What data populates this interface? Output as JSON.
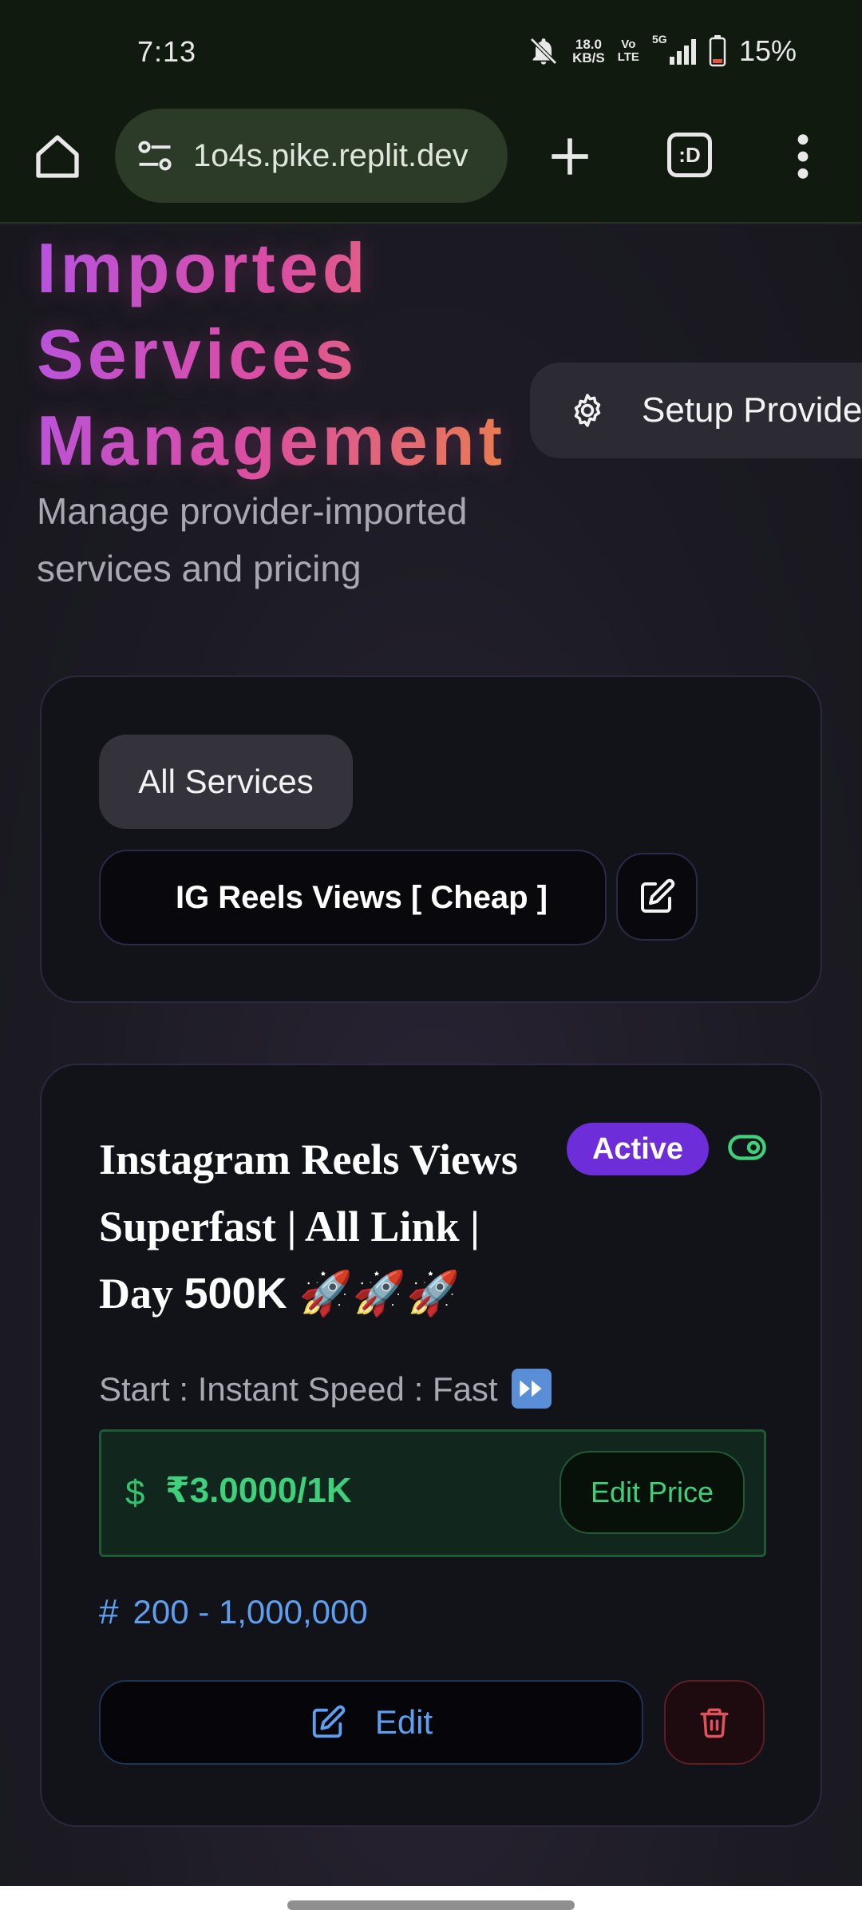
{
  "status_bar": {
    "time": "7:13",
    "net_speed_value": "18.0",
    "net_speed_unit": "KB/S",
    "volte_top": "Vo",
    "volte_bottom": "LTE",
    "signal_label": "5G",
    "battery": "15%",
    "icons": [
      "bell-off-icon",
      "signal-icon",
      "battery-icon"
    ]
  },
  "browser": {
    "url": "1o4s.pike.replit.dev",
    "tab_switcher_label": ":D",
    "icons": [
      "home-icon",
      "site-settings-icon",
      "plus-icon",
      "more-vert-icon"
    ]
  },
  "header": {
    "title_lines": [
      "Imported",
      "Services",
      "Management"
    ],
    "subtitle": "Manage provider-imported services and pricing",
    "setup_button": "Setup Provider"
  },
  "filters": {
    "all_services": "All Services",
    "category": "IG Reels Views [ Cheap ]"
  },
  "service": {
    "name": "Instagram Reels Views Superfast | All Link | Day",
    "name_tail": "500K 🚀🚀🚀",
    "status": "Active",
    "meta": "Start : Instant Speed : Fast",
    "currency_symbol": "$",
    "price": "₹3.0000/1K",
    "edit_price_label": "Edit Price",
    "range_symbol": "#",
    "range": "200 - 1,000,000",
    "edit_label": "Edit"
  },
  "colors": {
    "title_gradient": [
      "#b455e6",
      "#dd4fa2",
      "#ee8a3a"
    ],
    "active_badge": "#6d2ed9",
    "price_green": "#3fd07c",
    "range_blue": "#5e9ff0",
    "delete_red": "#e0525c"
  }
}
